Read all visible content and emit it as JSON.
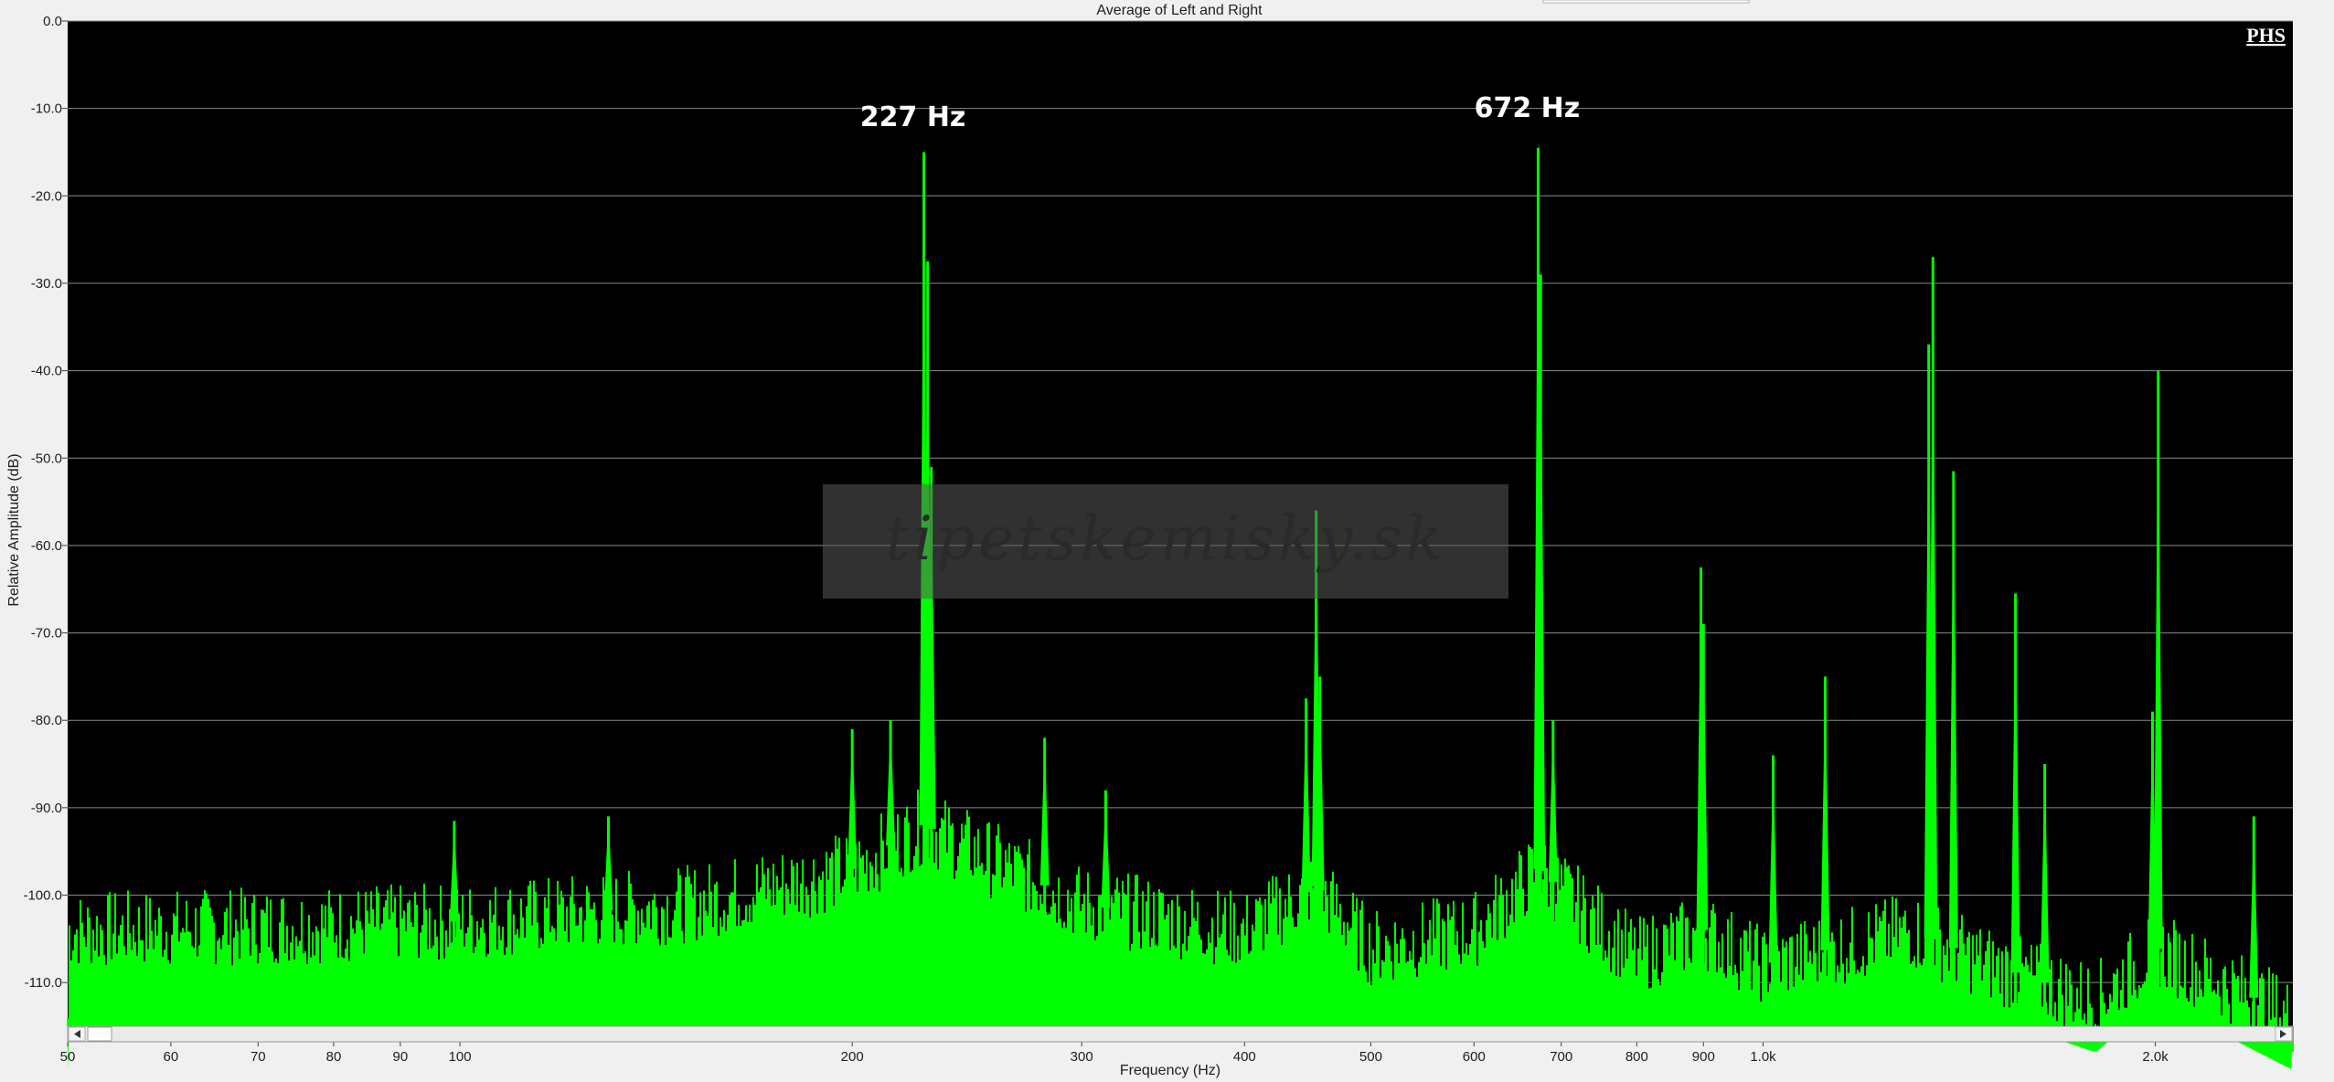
{
  "chart_data": {
    "type": "area",
    "title": "Average of Left and Right",
    "xlabel": "Frequency (Hz)",
    "ylabel": "Relative Amplitude (dB)",
    "x_scale": "log",
    "xlim": [
      50,
      2550
    ],
    "ylim": [
      -115,
      0
    ],
    "grid": true,
    "x_tick_labels": [
      "50",
      "60",
      "70",
      "80",
      "90",
      "100",
      "200",
      "300",
      "400",
      "500",
      "600",
      "700",
      "800",
      "900",
      "1.0k",
      "2.0k"
    ],
    "x_tick_values": [
      50,
      60,
      70,
      80,
      90,
      100,
      200,
      300,
      400,
      500,
      600,
      700,
      800,
      900,
      1000,
      2000
    ],
    "y_tick_labels": [
      "0.0",
      "-10.0",
      "-20.0",
      "-30.0",
      "-40.0",
      "-50.0",
      "-60.0",
      "-70.0",
      "-80.0",
      "-90.0",
      "-100.0",
      "-110.0"
    ],
    "y_tick_values": [
      0,
      -10,
      -20,
      -30,
      -40,
      -50,
      -60,
      -70,
      -80,
      -90,
      -100,
      -110
    ],
    "series": [
      {
        "color": "#00ff00",
        "noise_floor": [
          [
            50,
            -104
          ],
          [
            100,
            -103
          ],
          [
            150,
            -101
          ],
          [
            200,
            -97
          ],
          [
            227,
            -92
          ],
          [
            300,
            -101
          ],
          [
            400,
            -104
          ],
          [
            454,
            -99
          ],
          [
            500,
            -106
          ],
          [
            600,
            -104
          ],
          [
            672,
            -97
          ],
          [
            800,
            -107
          ],
          [
            900,
            -104
          ],
          [
            1000,
            -108
          ],
          [
            1300,
            -104
          ],
          [
            1500,
            -108
          ],
          [
            1800,
            -112
          ],
          [
            2000,
            -106
          ],
          [
            2550,
            -114
          ]
        ],
        "peaks": [
          {
            "x": 99,
            "y": -91.5
          },
          {
            "x": 130,
            "y": -91
          },
          {
            "x": 200,
            "y": -81
          },
          {
            "x": 214,
            "y": -80
          },
          {
            "x": 227,
            "y": -15
          },
          {
            "x": 228.5,
            "y": -27.5
          },
          {
            "x": 230,
            "y": -51
          },
          {
            "x": 281,
            "y": -82
          },
          {
            "x": 313,
            "y": -88
          },
          {
            "x": 446,
            "y": -77.5
          },
          {
            "x": 454,
            "y": -56
          },
          {
            "x": 457,
            "y": -75
          },
          {
            "x": 672,
            "y": -14.5
          },
          {
            "x": 675,
            "y": -29
          },
          {
            "x": 690,
            "y": -80
          },
          {
            "x": 896,
            "y": -62.5
          },
          {
            "x": 900,
            "y": -69
          },
          {
            "x": 1018,
            "y": -84
          },
          {
            "x": 1116,
            "y": -75
          },
          {
            "x": 1340,
            "y": -37
          },
          {
            "x": 1350,
            "y": -27
          },
          {
            "x": 1400,
            "y": -51.5
          },
          {
            "x": 1562,
            "y": -65.5
          },
          {
            "x": 1645,
            "y": -85
          },
          {
            "x": 1990,
            "y": -79
          },
          {
            "x": 2010,
            "y": -40
          },
          {
            "x": 2380,
            "y": -91
          }
        ]
      }
    ],
    "annotations": [
      {
        "text": "227 Hz",
        "x": 227,
        "y": -12
      },
      {
        "text": "672 Hz",
        "x": 672,
        "y": -11
      }
    ]
  },
  "brand_mark": "PHS",
  "watermark": "tipetskemisky.sk",
  "colors": {
    "plot_background": "#000000",
    "gridline": "#8a8a8a",
    "spectrum": "#00ff00",
    "frame": "#f0f0f0"
  },
  "scrollbar": {
    "left_arrow_icon": "triangle-left-icon",
    "right_arrow_icon": "triangle-right-icon"
  }
}
